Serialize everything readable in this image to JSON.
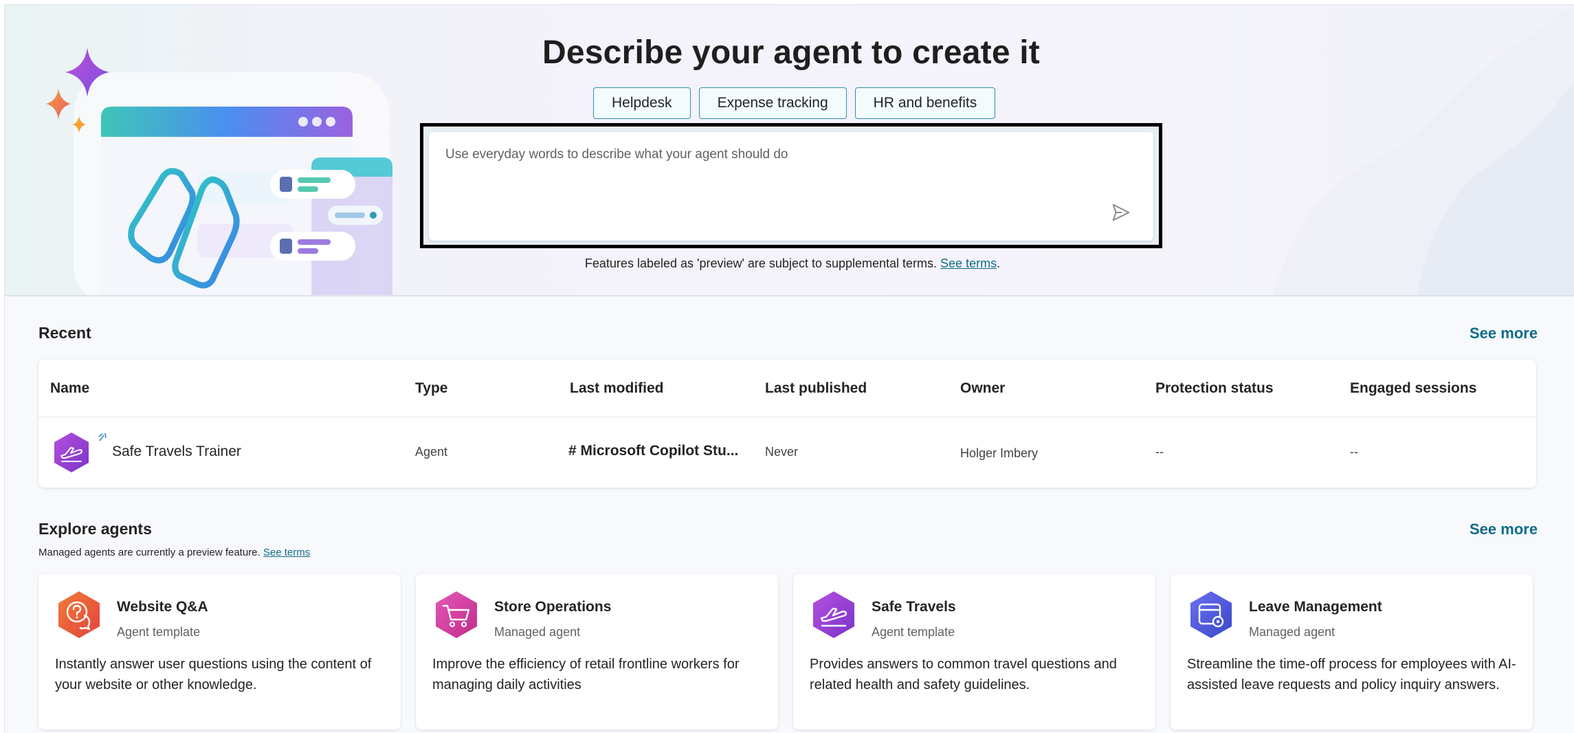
{
  "hero": {
    "title": "Describe your agent to create it",
    "chips": [
      "Helpdesk",
      "Expense tracking",
      "HR and benefits"
    ],
    "prompt_placeholder": "Use everyday words to describe what your agent should do",
    "prompt_value": "",
    "disclaimer_text": "Features labeled as 'preview' are subject to supplemental terms. ",
    "disclaimer_link": "See terms",
    "disclaimer_end": "."
  },
  "recent": {
    "title": "Recent",
    "see_more": "See more",
    "columns": [
      "Name",
      "Type",
      "Last modified",
      "Last published",
      "Owner",
      "Protection status",
      "Engaged sessions"
    ],
    "rows": [
      {
        "name": "Safe Travels Trainer",
        "type": "Agent",
        "last_modified": "# Microsoft Copilot Stu...",
        "last_published": "Never",
        "owner": "Holger Imbery",
        "protection_status": "--",
        "engaged_sessions": "--"
      }
    ]
  },
  "explore": {
    "title": "Explore agents",
    "subtitle": "Managed agents are currently a preview feature. ",
    "subtitle_link": "See terms",
    "see_more": "See more",
    "cards": [
      {
        "title": "Website Q&A",
        "subtitle": "Agent template",
        "description": "Instantly answer user questions using the content of your website or other knowledge.",
        "icon": "question-chat-icon",
        "color": "#e8552e"
      },
      {
        "title": "Store Operations",
        "subtitle": "Managed agent",
        "description": "Improve the efficiency of retail frontline workers for managing daily activities",
        "icon": "shopping-cart-icon",
        "color": "#d13aa0"
      },
      {
        "title": "Safe Travels",
        "subtitle": "Agent template",
        "description": "Provides answers to common travel questions and related health and safety guidelines.",
        "icon": "airplane-icon",
        "color": "#9b3fd6"
      },
      {
        "title": "Leave Management",
        "subtitle": "Managed agent",
        "description": "Streamline the time-off process for employees with AI-assisted leave requests and policy inquiry answers.",
        "icon": "calendar-settings-icon",
        "color": "#4e5bdc"
      }
    ]
  },
  "colors": {
    "accent": "#0f6c8a",
    "chip_border": "#2c8fa8"
  }
}
